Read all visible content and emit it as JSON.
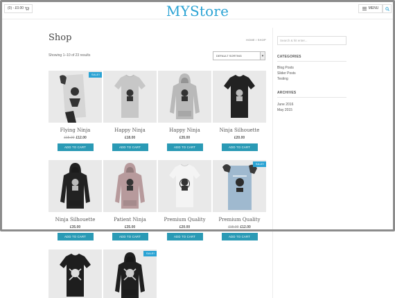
{
  "header": {
    "cart_label": "(0) - £0.00",
    "site_title": "MYStore",
    "menu_label": "MENU"
  },
  "main": {
    "page_title": "Shop",
    "breadcrumb": "HOME / SHOP",
    "result_count": "Showing 1–10 of 23 results",
    "sort_selected": "DEFAULT SORTING"
  },
  "sidebar": {
    "search_placeholder": "Search & hit enter...",
    "categories_title": "CATEGORIES",
    "categories": [
      "Blog Posts",
      "Slider Posts",
      "Testing"
    ],
    "archives_title": "ARCHIVES",
    "archives": [
      "June 2016",
      "May 2015"
    ]
  },
  "products": [
    {
      "name": "Flying Ninja",
      "old_price": "£15.00",
      "price": "£12.00",
      "sale": "SALE!",
      "button": "ADD TO CART",
      "kind": "poster-ninja"
    },
    {
      "name": "Happy Ninja",
      "old_price": "",
      "price": "£18.00",
      "sale": "",
      "button": "ADD TO CART",
      "kind": "tee-grey"
    },
    {
      "name": "Happy Ninja",
      "old_price": "",
      "price": "£35.00",
      "sale": "",
      "button": "ADD TO CART",
      "kind": "hoodie-grey"
    },
    {
      "name": "Ninja Silhouette",
      "old_price": "",
      "price": "£20.00",
      "sale": "",
      "button": "ADD TO CART",
      "kind": "tee-black"
    },
    {
      "name": "Ninja Silhouette",
      "old_price": "",
      "price": "£35.00",
      "sale": "",
      "button": "ADD TO CART",
      "kind": "hoodie-black"
    },
    {
      "name": "Patient Ninja",
      "old_price": "",
      "price": "£35.00",
      "sale": "",
      "button": "ADD TO CART",
      "kind": "hoodie-mauve"
    },
    {
      "name": "Premium Quality",
      "old_price": "",
      "price": "£20.00",
      "sale": "",
      "button": "ADD TO CART",
      "kind": "tee-white"
    },
    {
      "name": "Premium Quality",
      "old_price": "£15.00",
      "price": "£12.00",
      "sale": "SALE!",
      "button": "ADD TO CART",
      "kind": "poster-blue"
    },
    {
      "name": "",
      "old_price": "",
      "price": "",
      "sale": "",
      "button": "",
      "kind": "tee-black-skull"
    },
    {
      "name": "",
      "old_price": "",
      "price": "",
      "sale": "SALE!",
      "button": "",
      "kind": "hoodie-black-skull"
    }
  ],
  "colors": {
    "accent": "#2aa3d4",
    "button": "#2a9ab5"
  }
}
